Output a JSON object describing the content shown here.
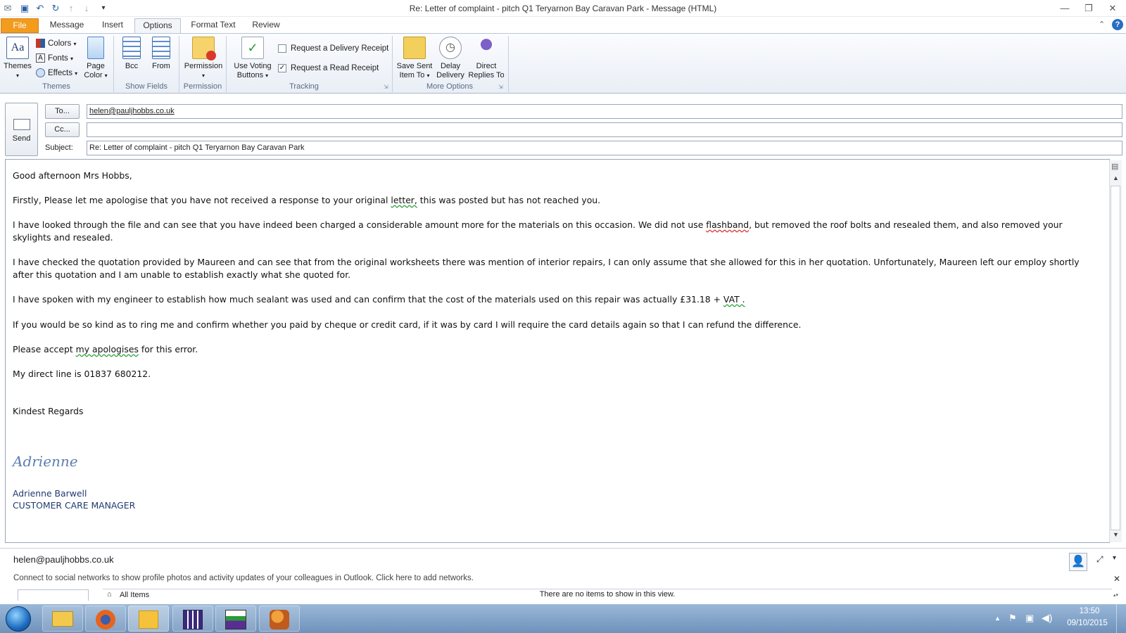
{
  "window": {
    "title": "Re: Letter of complaint - pitch Q1 Teryarnon Bay Caravan Park  -  Message (HTML)"
  },
  "tabs": [
    {
      "label": "File"
    },
    {
      "label": "Message"
    },
    {
      "label": "Insert"
    },
    {
      "label": "Options"
    },
    {
      "label": "Format Text"
    },
    {
      "label": "Review"
    }
  ],
  "ribbon": {
    "themes": {
      "themes_label": "Themes",
      "colors_label": "Colors",
      "fonts_label": "Fonts",
      "effects_label": "Effects",
      "page_color_line1": "Page",
      "page_color_line2": "Color",
      "group_label": "Themes"
    },
    "show_fields": {
      "bcc_label": "Bcc",
      "from_label": "From",
      "group_label": "Show Fields"
    },
    "permission": {
      "permission_label": "Permission",
      "group_label": "Permission"
    },
    "tracking": {
      "voting_line1": "Use Voting",
      "voting_line2": "Buttons",
      "delivery_receipt_label": "Request a Delivery Receipt",
      "delivery_receipt_checked": false,
      "read_receipt_label": "Request a Read Receipt",
      "read_receipt_checked": true,
      "group_label": "Tracking"
    },
    "more_options": {
      "save_sent_line1": "Save Sent",
      "save_sent_line2": "Item To",
      "delay_line1": "Delay",
      "delay_line2": "Delivery",
      "direct_line1": "Direct",
      "direct_line2": "Replies To",
      "group_label": "More Options"
    }
  },
  "compose": {
    "send_label": "Send",
    "to_button": "To...",
    "to_value": "helen@pauljhobbs.co.uk",
    "cc_button": "Cc...",
    "cc_value": "",
    "subject_label": "Subject:",
    "subject_value": "Re: Letter of complaint - pitch Q1 Teryarnon Bay Caravan Park"
  },
  "body": {
    "greeting": "Good afternoon Mrs Hobbs,",
    "p1_before": "Firstly, Please let me apologise that you have not received a response to your original ",
    "p1_squiggle": "letter,",
    "p1_after": " this was posted but has not reached you.",
    "p2_before": "I have looked through the file and can see that you have indeed been charged a considerable amount more for the materials on this occasion.  We did not use ",
    "p2_squiggle": "flashband",
    "p2_after": ", but removed the roof bolts and resealed them, and also removed your skylights and resealed.",
    "p3": "I have checked the quotation provided by Maureen and can see that from the original worksheets there was mention of interior repairs, I can only assume that she allowed for this in her quotation.  Unfortunately, Maureen left our employ shortly after this quotation and I am unable to establish exactly what she quoted for.",
    "p4_before": "I have spoken with my engineer to establish how much sealant was used and can confirm that the cost of the materials used on this repair was actually £31.18 + ",
    "p4_squiggle": "VAT .",
    "p5": "If you would be so kind as to ring me and confirm whether you paid by cheque or credit card, if it was by card I will require the card details again so that I can refund the difference.",
    "p6_before": "Please accept ",
    "p6_squiggle": "my apologises",
    "p6_after": " for this error.",
    "p7": "My direct line is 01837 680212.",
    "closing": "Kindest Regards",
    "signature_script": "Adrienne",
    "signature_name": "Adrienne Barwell",
    "signature_title": "CUSTOMER CARE MANAGER"
  },
  "people_pane": {
    "contact": "helen@pauljhobbs.co.uk",
    "social_text": "Connect to social networks to show profile photos and activity updates of your colleagues in Outlook. Click here to add networks.",
    "all_items": "All Items",
    "no_items": "There are no items to show in this view."
  },
  "taskbar": {
    "time": "13:50",
    "date": "09/10/2015"
  },
  "colors": {
    "file_tab": "#f29b1d",
    "signature_blue": "#1f3a70",
    "taskbar": "#7d9ec6"
  }
}
